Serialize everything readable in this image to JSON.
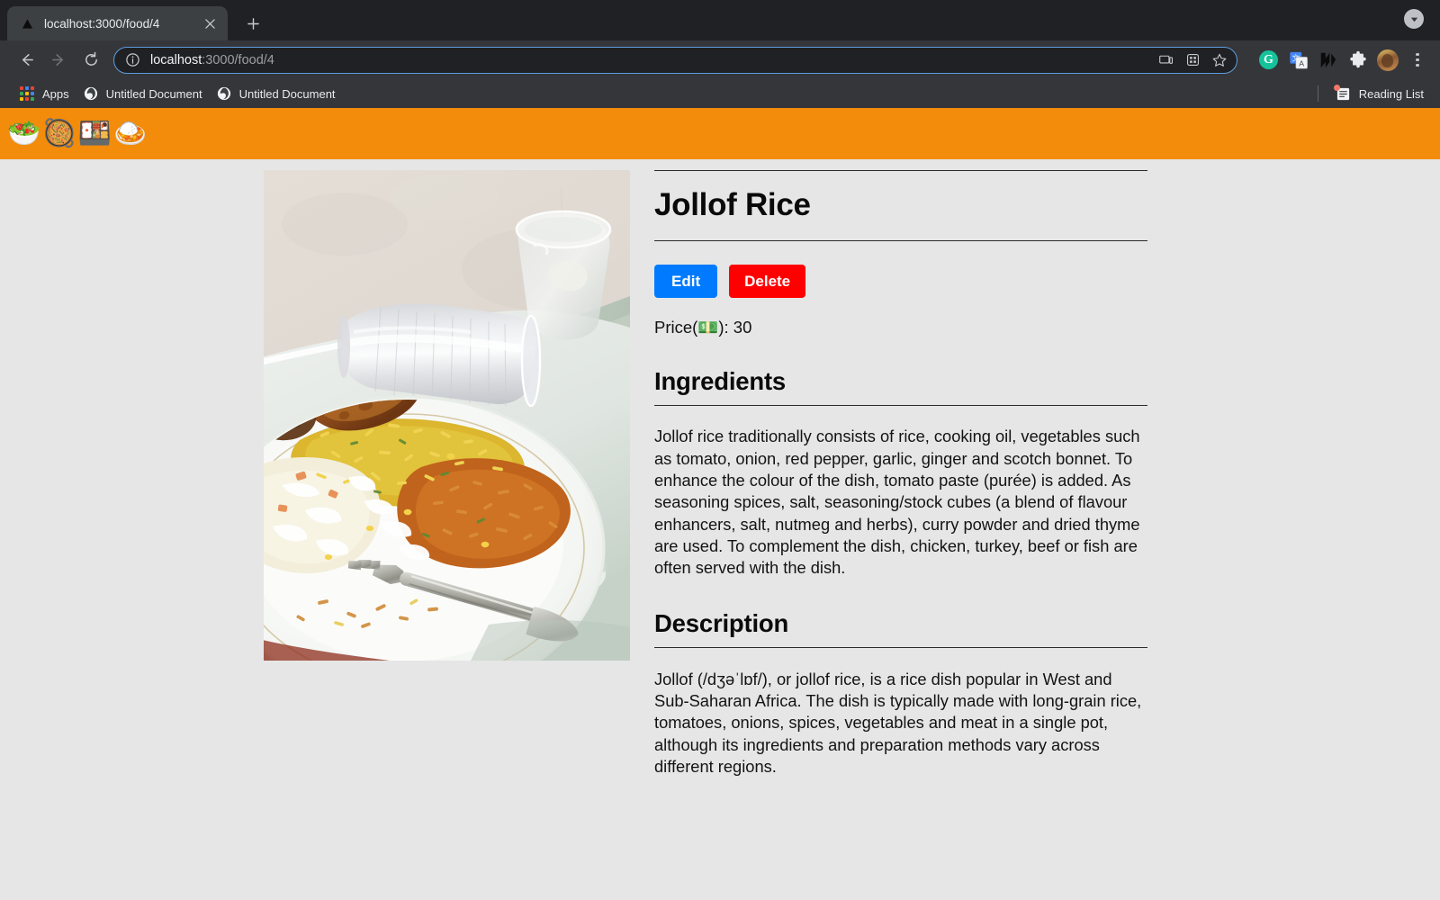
{
  "browser": {
    "tab": {
      "title": "localhost:3000/food/4",
      "favicon_icon": "nextjs-triangle-icon",
      "close_icon": "close-icon",
      "newtab_icon": "plus-icon",
      "caret_icon": "chevron-down-icon"
    },
    "nav": {
      "back_icon": "arrow-left-icon",
      "forward_icon": "arrow-right-icon",
      "reload_icon": "reload-icon"
    },
    "omnibox": {
      "info_icon": "info-circle-icon",
      "url_host": "localhost",
      "url_path": ":3000/food/4",
      "cast_icon": "cast-device-icon",
      "qr_icon": "qr-code-icon",
      "star_icon": "star-bookmark-icon"
    },
    "extensions": [
      {
        "name": "grammarly-extension-icon",
        "label": "G"
      },
      {
        "name": "google-translate-extension-icon",
        "label": ""
      },
      {
        "name": "m-extension-icon",
        "label": ""
      },
      {
        "name": "puzzle-extensions-icon",
        "label": ""
      },
      {
        "name": "profile-avatar",
        "label": ""
      }
    ],
    "menu_icon": "kebab-menu-icon",
    "bookmarks": [
      {
        "label": "Apps",
        "icon": "apps-grid-icon"
      },
      {
        "label": "Untitled Document",
        "icon": "globe-icon"
      },
      {
        "label": "Untitled Document",
        "icon": "globe-icon"
      }
    ],
    "reading_list": {
      "label": "Reading List",
      "icon": "reading-list-icon",
      "has_notification": true
    }
  },
  "site": {
    "header_emojis": [
      "🥗",
      "🥘",
      "🍱",
      "🍛"
    ],
    "header_color": "#F28C0A",
    "page_background": "#E6E6E6"
  },
  "food": {
    "title": "Jollof Rice",
    "image_alt": "Plate of jollof rice with fried chicken and coleslaw on a white tray",
    "actions": {
      "edit_label": "Edit",
      "edit_color": "#007BFF",
      "delete_label": "Delete",
      "delete_color": "#FF0000"
    },
    "price_label": "Price(💵): 30",
    "ingredients": {
      "heading": "Ingredients",
      "text": "Jollof rice traditionally consists of rice, cooking oil, vegetables such as tomato, onion, red pepper, garlic, ginger and scotch bonnet. To enhance the colour of the dish, tomato paste (purée) is added. As seasoning spices, salt, seasoning/stock cubes (a blend of flavour enhancers, salt, nutmeg and herbs), curry powder and dried thyme are used. To complement the dish, chicken, turkey, beef or fish are often served with the dish."
    },
    "description": {
      "heading": "Description",
      "text": "Jollof (/dʒəˈlɒf/), or jollof rice, is a rice dish popular in West and Sub-Saharan Africa. The dish is typically made with long-grain rice, tomatoes, onions, spices, vegetables and meat in a single pot, although its ingredients and preparation methods vary across different regions."
    }
  }
}
